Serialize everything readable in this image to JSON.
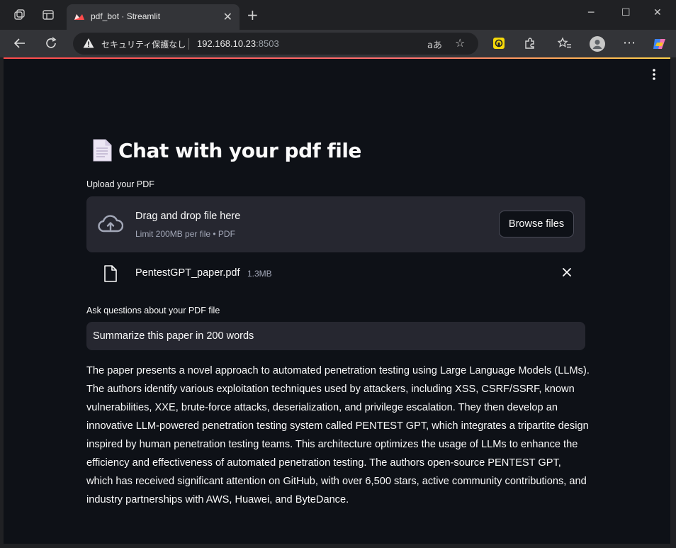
{
  "browser": {
    "tab_title": "pdf_bot · Streamlit",
    "security_label": "セキュリティ保護なし",
    "url_host": "192.168.10.23",
    "url_port": ":8503",
    "translate_glyph": "aあ"
  },
  "app": {
    "title": "Chat with your pdf file",
    "upload_label": "Upload your PDF",
    "dropzone": {
      "main_text": "Drag and drop file here",
      "sub_text": "Limit 200MB per file • PDF",
      "browse_label": "Browse files"
    },
    "uploaded_file": {
      "name": "PentestGPT_paper.pdf",
      "size": "1.3MB"
    },
    "question_label": "Ask questions about your PDF file",
    "question_value": "Summarize this paper in 200 words",
    "answer": "The paper presents a novel approach to automated penetration testing using Large Language Models (LLMs). The authors identify various exploitation techniques used by attackers, including XSS, CSRF/SSRF, known vulnerabilities, XXE, brute-force attacks, deserialization, and privilege escalation. They then develop an innovative LLM-powered penetration testing system called PENTEST GPT, which integrates a tripartite design inspired by human penetration testing teams. This architecture optimizes the usage of LLMs to enhance the efficiency and effectiveness of automated penetration testing. The authors open-source PENTEST GPT, which has received significant attention on GitHub, with over 6,500 stars, active community contributions, and industry partnerships with AWS, Huawei, and ByteDance."
  },
  "colors": {
    "app_bg": "#0e1117",
    "widget_bg": "#262730",
    "accent_red": "#ff4b4b",
    "browser_chrome": "#333438"
  },
  "icons": {
    "workspaces": "workspaces-icon",
    "tab_actions": "tab-actions-icon",
    "streamlit_logo": "streamlit-logo-icon",
    "back": "back-arrow-icon",
    "refresh": "refresh-icon",
    "warning": "warning-icon",
    "cloud_upload": "cloud-upload-icon",
    "file": "file-icon",
    "close": "close-icon",
    "menu": "kebab-menu-icon"
  }
}
